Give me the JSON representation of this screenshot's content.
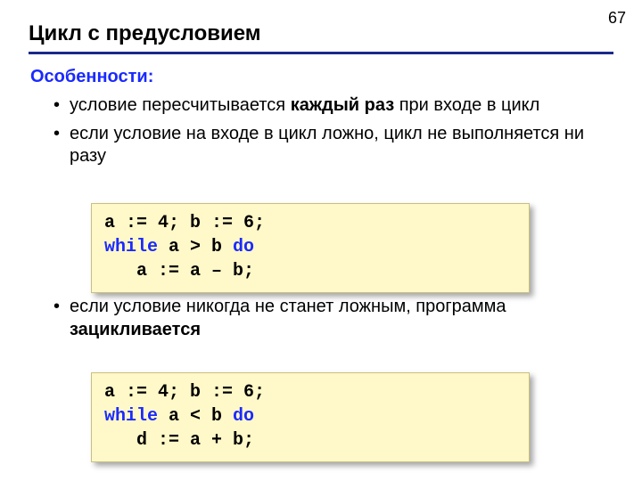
{
  "page_number": "67",
  "title": "Цикл с предусловием",
  "subhead": "Особенности:",
  "bullets": {
    "b1_pre": "условие пересчитывается ",
    "b1_bold": "каждый раз",
    "b1_post": " при входе в цикл",
    "b2": "если условие на входе в цикл ложно, цикл не выполняется ни разу",
    "b3_pre": "если условие никогда не станет ложным, программа ",
    "b3_bold": "зацикливается"
  },
  "code1": {
    "l1": "a := 4; b := 6;",
    "l2a": "while",
    "l2b": " a > b ",
    "l2c": "do",
    "l3": "   a := a – b;"
  },
  "code2": {
    "l1": "a := 4; b := 6;",
    "l2a": "while",
    "l2b": " a < b ",
    "l2c": "do",
    "l3": "   d := a + b;"
  }
}
